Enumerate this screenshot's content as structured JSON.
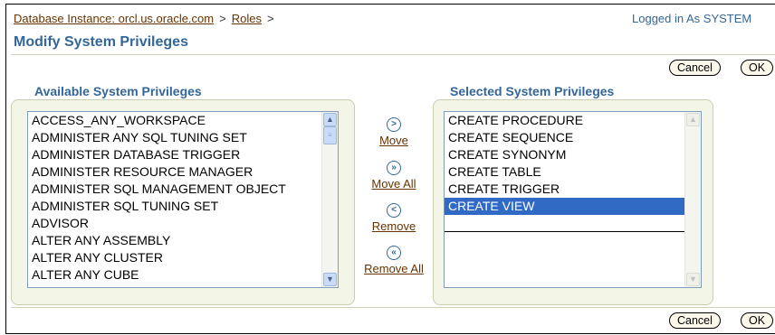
{
  "breadcrumb": {
    "db_instance": "Database Instance: orcl.us.oracle.com",
    "sep1": ">",
    "roles": "Roles",
    "sep2": ">"
  },
  "logged_in": "Logged in As SYSTEM",
  "page_title": "Modify System Privileges",
  "buttons": {
    "cancel": "Cancel",
    "ok": "OK"
  },
  "available": {
    "header": "Available System Privileges",
    "items": [
      "ACCESS_ANY_WORKSPACE",
      "ADMINISTER ANY SQL TUNING SET",
      "ADMINISTER DATABASE TRIGGER",
      "ADMINISTER RESOURCE MANAGER",
      "ADMINISTER SQL MANAGEMENT OBJECT",
      "ADMINISTER SQL TUNING SET",
      "ADVISOR",
      "ALTER ANY ASSEMBLY",
      "ALTER ANY CLUSTER",
      "ALTER ANY CUBE"
    ]
  },
  "selected": {
    "header": "Selected System Privileges",
    "items": [
      "CREATE PROCEDURE",
      "CREATE SEQUENCE",
      "CREATE SYNONYM",
      "CREATE TABLE",
      "CREATE TRIGGER",
      "CREATE VIEW"
    ],
    "highlighted": "CREATE VIEW"
  },
  "shuttle": {
    "move": "Move",
    "move_all": "Move All",
    "remove": "Remove",
    "remove_all": "Remove All"
  },
  "colors": {
    "header_blue": "#336699",
    "link_brown": "#663300",
    "selection": "#316ac5",
    "panel_bg": "#f3f5e6"
  },
  "icons": {
    "move": "move-right-icon",
    "move_all": "move-all-right-icon",
    "remove": "remove-left-icon",
    "remove_all": "remove-all-left-icon"
  }
}
